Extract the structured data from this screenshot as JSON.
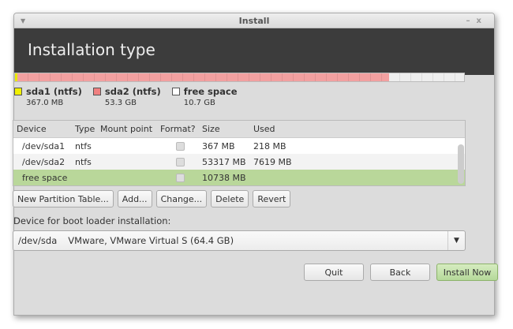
{
  "window": {
    "title": "Install",
    "header": "Installation type"
  },
  "partition_bar": {
    "segments": [
      {
        "fraction": 0.0057,
        "color": "#e8e800"
      },
      {
        "fraction": 0.8277,
        "color": "#f2a0a0"
      },
      {
        "fraction": 0.1666,
        "color": "#eeeeee"
      }
    ]
  },
  "legend": [
    {
      "name": "sda1 (ntfs)",
      "size": "367.0 MB",
      "color": "#f0f000"
    },
    {
      "name": "sda2 (ntfs)",
      "size": "53.3 GB",
      "color": "#f08080"
    },
    {
      "name": "free space",
      "size": "10.7 GB",
      "color": "#ffffff"
    }
  ],
  "table": {
    "headers": [
      "Device",
      "Type",
      "Mount point",
      "Format?",
      "Size",
      "Used"
    ],
    "rows": [
      {
        "device": "/dev/sda1",
        "type": "ntfs",
        "mount": "",
        "size": "367 MB",
        "used": "218 MB"
      },
      {
        "device": "/dev/sda2",
        "type": "ntfs",
        "mount": "",
        "size": "53317 MB",
        "used": "7619 MB"
      },
      {
        "device": "free space",
        "type": "",
        "mount": "",
        "size": "10738 MB",
        "used": ""
      }
    ]
  },
  "buttons": {
    "new_table": "New Partition Table...",
    "add": "Add...",
    "change": "Change...",
    "delete": "Delete",
    "revert": "Revert"
  },
  "bootloader": {
    "label": "Device for boot loader installation:",
    "device": "/dev/sda",
    "desc": "VMware, VMware Virtual S (64.4 GB)"
  },
  "footer": {
    "quit": "Quit",
    "back": "Back",
    "install": "Install Now"
  }
}
